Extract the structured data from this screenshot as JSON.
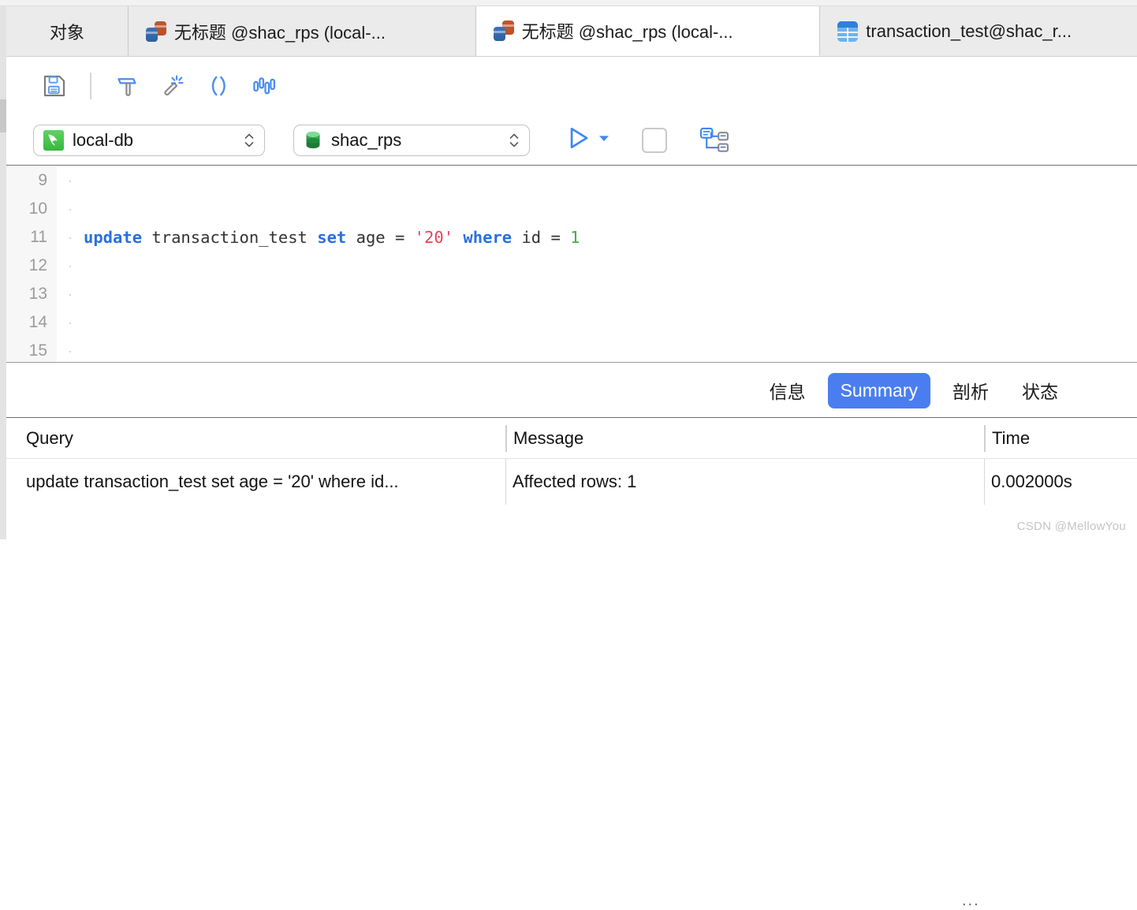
{
  "window": {
    "tabs": [
      {
        "label": "对象",
        "icon": "none",
        "active": false,
        "kind": "objects"
      },
      {
        "label": "无标题 @shac_rps (local-...",
        "icon": "query-icon",
        "active": false,
        "kind": "query"
      },
      {
        "label": "无标题 @shac_rps (local-...",
        "icon": "query-icon",
        "active": true,
        "kind": "query"
      },
      {
        "label": "transaction_test@shac_r...",
        "icon": "table-icon",
        "active": false,
        "kind": "table"
      }
    ]
  },
  "toolbar": {
    "buttons": [
      {
        "name": "save-icon",
        "title": "保存"
      },
      {
        "name": "build-icon",
        "title": "格式化"
      },
      {
        "name": "magic-wand-icon",
        "title": "美化 SQL"
      },
      {
        "name": "parentheses-icon",
        "title": "代码片段"
      },
      {
        "name": "bar-chart-icon",
        "title": "图表"
      }
    ]
  },
  "connection": {
    "database_connection": {
      "value": "local-db",
      "icon": "mysql-dolphin-icon"
    },
    "schema": {
      "value": "shac_rps",
      "icon": "database-icon"
    },
    "run": {
      "name": "run-button",
      "icon": "play-icon",
      "dropdown_icon": "caret-down-icon"
    },
    "stop": {
      "name": "stop-button",
      "checked": false
    },
    "explain": {
      "name": "explain-plan-button",
      "icon": "explain-plan-icon"
    }
  },
  "editor": {
    "lines": [
      {
        "number": "9",
        "tokens": []
      },
      {
        "number": "10",
        "tokens": []
      },
      {
        "number": "11",
        "tokens": [
          {
            "t": "update",
            "c": "kw"
          },
          {
            "t": " transaction_test ",
            "c": "plain"
          },
          {
            "t": "set",
            "c": "kw"
          },
          {
            "t": " age = ",
            "c": "plain"
          },
          {
            "t": "'20'",
            "c": "str"
          },
          {
            "t": " ",
            "c": "plain"
          },
          {
            "t": "where",
            "c": "kw"
          },
          {
            "t": " id = ",
            "c": "plain"
          },
          {
            "t": "1",
            "c": "num"
          }
        ]
      },
      {
        "number": "12",
        "tokens": []
      },
      {
        "number": "13",
        "tokens": []
      },
      {
        "number": "14",
        "tokens": []
      },
      {
        "number": "15",
        "tokens": []
      }
    ]
  },
  "result_tabs": [
    {
      "label": "信息",
      "selected": false
    },
    {
      "label": "Summary",
      "selected": true
    },
    {
      "label": "剖析",
      "selected": false
    },
    {
      "label": "状态",
      "selected": false
    }
  ],
  "results": {
    "columns": [
      "Query",
      "Message",
      "Time"
    ],
    "rows": [
      {
        "query": "update transaction_test set age = '20' where id...",
        "message": "Affected rows: 1",
        "overflow": "...",
        "time": "0.002000s"
      }
    ]
  },
  "watermark": "CSDN @MellowYou",
  "colors": {
    "accent": "#4a7ef0",
    "keyword": "#2a6fe0",
    "string": "#e8415c",
    "number": "#3fae4a",
    "tabbar_bg": "#ebebeb"
  }
}
